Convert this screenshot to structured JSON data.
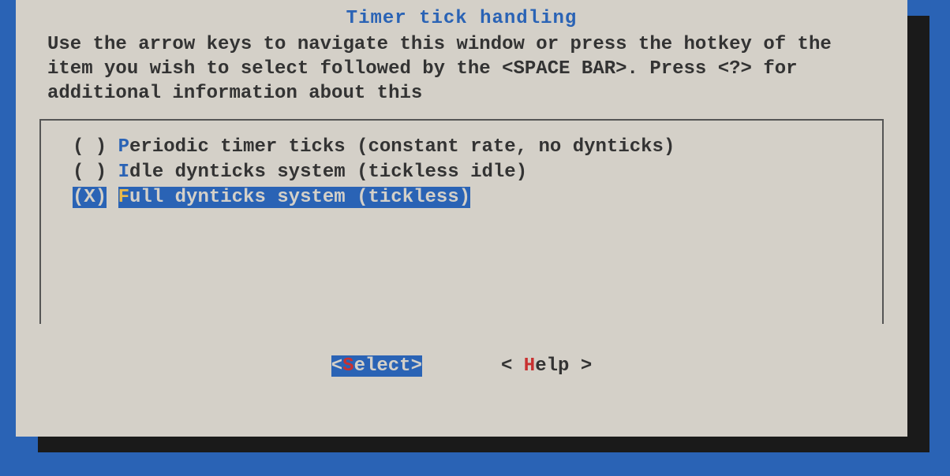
{
  "title": "Timer tick handling",
  "help_text": "Use the arrow keys to navigate this window or press the hotkey of the item you wish to select followed by the <SPACE BAR>. Press <?> for additional information about this",
  "options": [
    {
      "marker": "( )",
      "hotkey": "P",
      "rest": "eriodic timer ticks (constant rate, no dynticks)",
      "selected": false
    },
    {
      "marker": "( )",
      "hotkey": "I",
      "rest": "dle dynticks system (tickless idle)",
      "selected": false
    },
    {
      "marker": "(X)",
      "hotkey": "F",
      "rest": "ull dynticks system (tickless)",
      "selected": true
    }
  ],
  "buttons": {
    "select": {
      "open": "<",
      "hotkey": "S",
      "rest": "elect",
      "close": ">",
      "active": true
    },
    "help": {
      "open": "< ",
      "hotkey": "H",
      "rest": "elp",
      "close": " >",
      "active": false
    }
  }
}
